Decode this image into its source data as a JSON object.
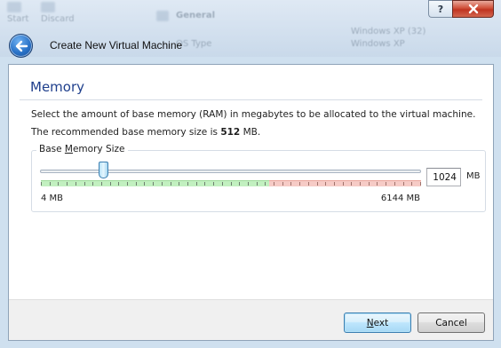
{
  "background": {
    "items": [
      "Start",
      "Discard",
      "General",
      "OS Type",
      "Windows XP (32)",
      "Windows XP"
    ]
  },
  "window": {
    "title": "Create New Virtual Machine",
    "help_label": "?",
    "close_label": "Close"
  },
  "page": {
    "heading": "Memory",
    "description": "Select the amount of base memory (RAM) in megabytes to be allocated to the virtual machine.",
    "recommended_prefix": "The recommended base memory size is ",
    "recommended_value": "512",
    "recommended_suffix": " MB."
  },
  "memory": {
    "group_label_pre": "Base ",
    "group_label_mnemonic": "M",
    "group_label_post": "emory Size",
    "min_label": "4 MB",
    "max_label": "6144 MB",
    "value": "1024",
    "unit": "MB",
    "min_value": 4,
    "max_value": 6144,
    "current_value": 1024,
    "green_fraction": 0.6,
    "orange_fraction": 0.8
  },
  "buttons": {
    "next_mnemonic": "N",
    "next_rest": "ext",
    "cancel": "Cancel"
  },
  "colors": {
    "heading": "#1f3f8c",
    "safe_range": "#c2f0c0",
    "warn_range": "#f6cbc6",
    "accent": "#3c7fb1"
  }
}
